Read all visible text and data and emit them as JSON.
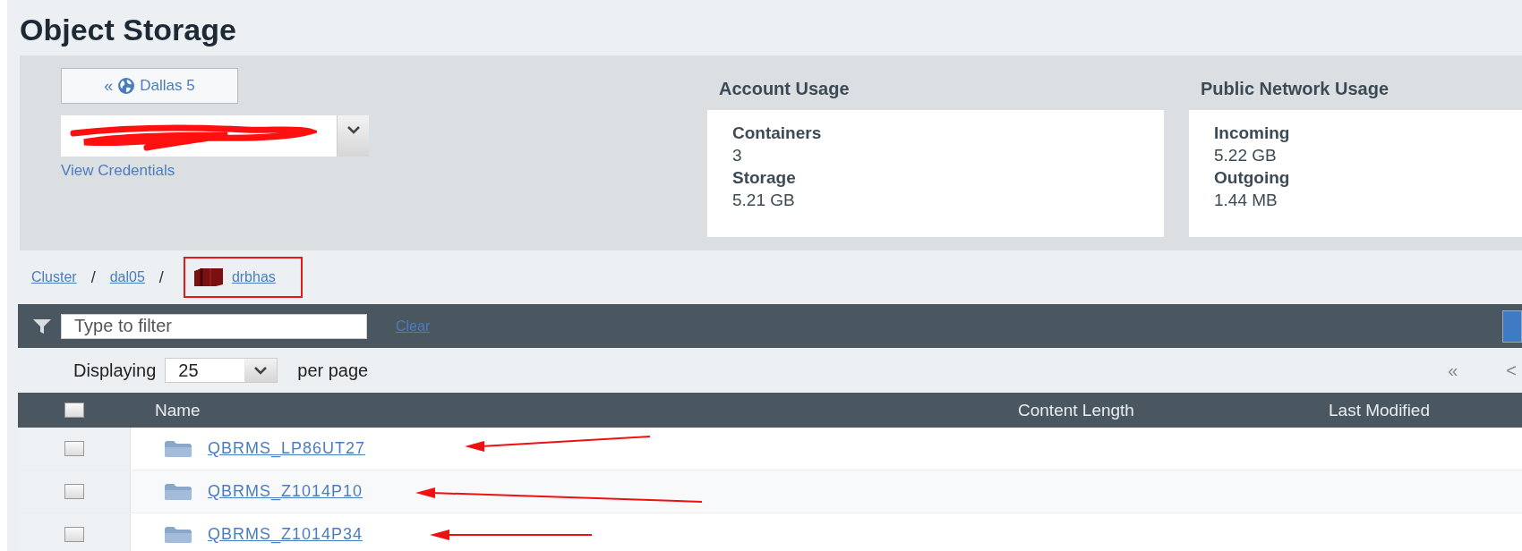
{
  "page_title": "Object Storage",
  "region_button": {
    "prefix": "«",
    "label": "Dallas 5"
  },
  "account_select": {
    "redacted": true
  },
  "view_credentials": "View Credentials",
  "usage_panels": [
    {
      "title": "Account Usage",
      "stats": [
        {
          "label": "Containers",
          "value": "3"
        },
        {
          "label": "Storage",
          "value": "5.21 GB"
        }
      ]
    },
    {
      "title": "Public Network Usage",
      "stats": [
        {
          "label": "Incoming",
          "value": "5.22 GB"
        },
        {
          "label": "Outgoing",
          "value": "1.44 MB"
        }
      ]
    }
  ],
  "breadcrumb": [
    {
      "kind": "link",
      "label": "Cluster"
    },
    {
      "kind": "separator",
      "label": "/"
    },
    {
      "kind": "link",
      "label": "dal05"
    },
    {
      "kind": "separator",
      "label": "/"
    },
    {
      "kind": "container",
      "label": "drbhas",
      "highlighted": true
    }
  ],
  "filter": {
    "placeholder": "Type to filter",
    "clear": "Clear"
  },
  "paging": {
    "label": "Displaying",
    "per_page": "25",
    "suffix": "per page",
    "first": "«",
    "prev": "<"
  },
  "table": {
    "select_all_checked": false,
    "columns": [
      "Name",
      "Content Length",
      "Last Modified"
    ],
    "rows": [
      {
        "name": "QBRMS_LP86UT27",
        "checked": false,
        "annotated": true
      },
      {
        "name": "QBRMS_Z1014P10",
        "checked": false,
        "annotated": true
      },
      {
        "name": "QBRMS_Z1014P34",
        "checked": false,
        "annotated": true
      }
    ]
  }
}
